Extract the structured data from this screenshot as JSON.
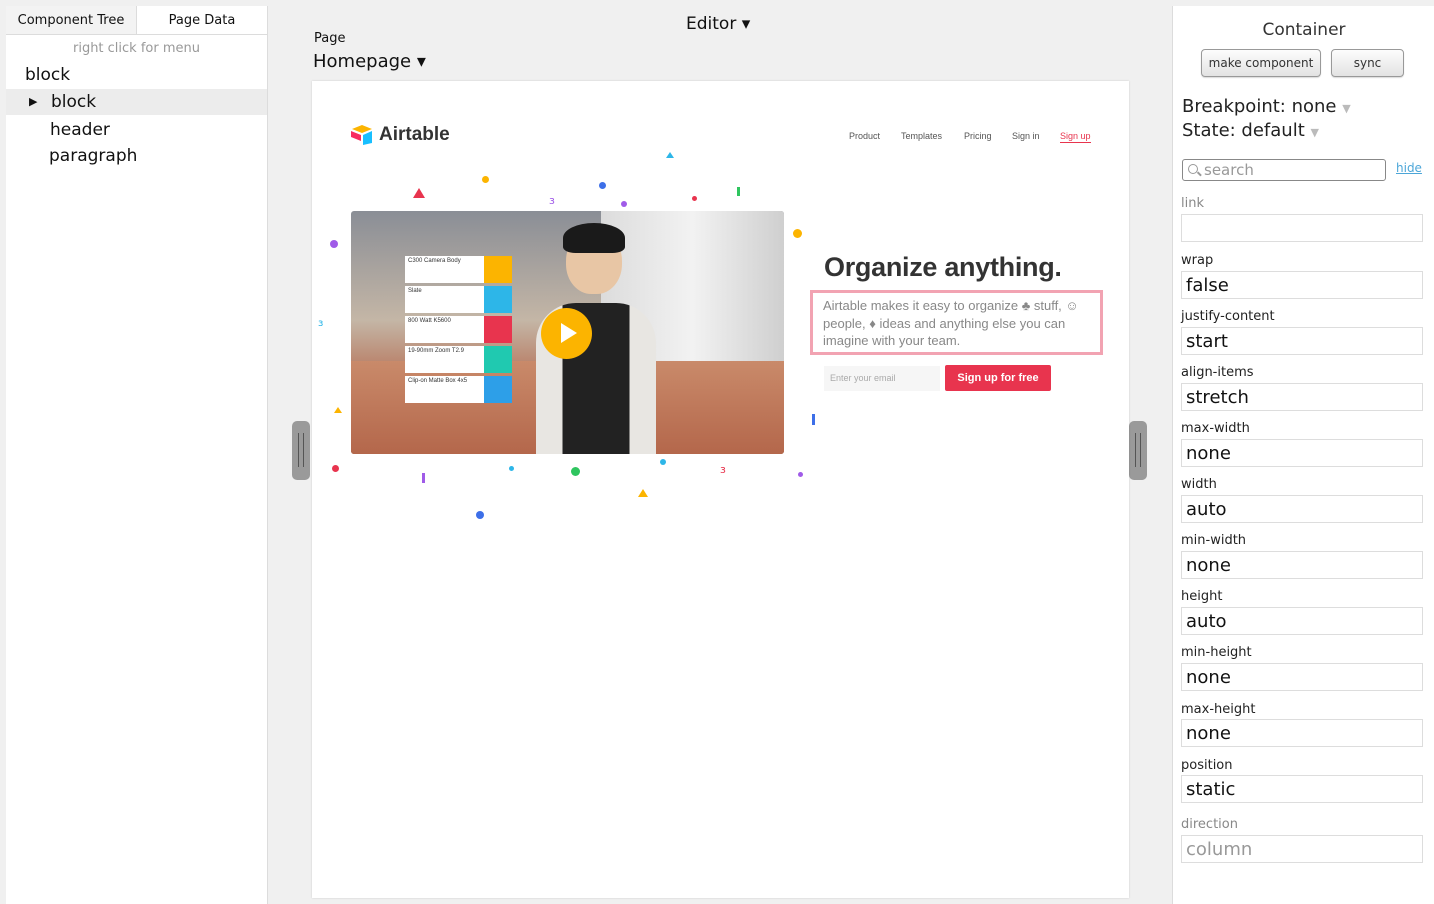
{
  "left_panel": {
    "tabs": [
      "Component Tree",
      "Page Data"
    ],
    "hint": "right click for menu",
    "tree": [
      {
        "label": "block",
        "level": 0
      },
      {
        "label": "block",
        "level": 1,
        "expandable": true,
        "selected": true
      },
      {
        "label": "header",
        "level": 2
      },
      {
        "label": "paragraph",
        "level": 2
      }
    ]
  },
  "center": {
    "title": "Editor ▾",
    "page_label": "Page",
    "page_value": "Homepage ▾"
  },
  "preview": {
    "logo_text": "Airtable",
    "nav": [
      "Product",
      "Templates",
      "Pricing",
      "Sign in",
      "Sign up"
    ],
    "video_cards": [
      "C300 Camera Body",
      "Slate",
      "800 Watt K5600",
      "19-90mm Zoom T2.9",
      "Clip-on Matte Box 4x5"
    ],
    "headline": "Organize anything.",
    "subtext": "Airtable makes it easy to organize ♣ stuff, ☺ people, ♦ ideas and anything else you can imagine with your team.",
    "email_placeholder": "Enter your email",
    "cta": "Sign up for free",
    "colors": {
      "brand_red": "#e8344e",
      "play_yellow": "#fcb400",
      "highlight_border": "#f2a3b2"
    }
  },
  "right_panel": {
    "title": "Container",
    "buttons": {
      "make_component": "make component",
      "sync": "sync"
    },
    "breakpoint": "Breakpoint: none",
    "state": "State: default",
    "search_placeholder": "search",
    "hide_label": "hide",
    "properties": [
      {
        "label": "link",
        "value": "",
        "muted": true
      },
      {
        "label": "wrap",
        "value": "false"
      },
      {
        "label": "justify-content",
        "value": "start"
      },
      {
        "label": "align-items",
        "value": "stretch"
      },
      {
        "label": "max-width",
        "value": "none"
      },
      {
        "label": "width",
        "value": "auto"
      },
      {
        "label": "min-width",
        "value": "none"
      },
      {
        "label": "height",
        "value": "auto"
      },
      {
        "label": "min-height",
        "value": "none"
      },
      {
        "label": "max-height",
        "value": "none"
      },
      {
        "label": "position",
        "value": "static"
      },
      {
        "label": "direction",
        "value": "column",
        "muted": true
      }
    ]
  }
}
